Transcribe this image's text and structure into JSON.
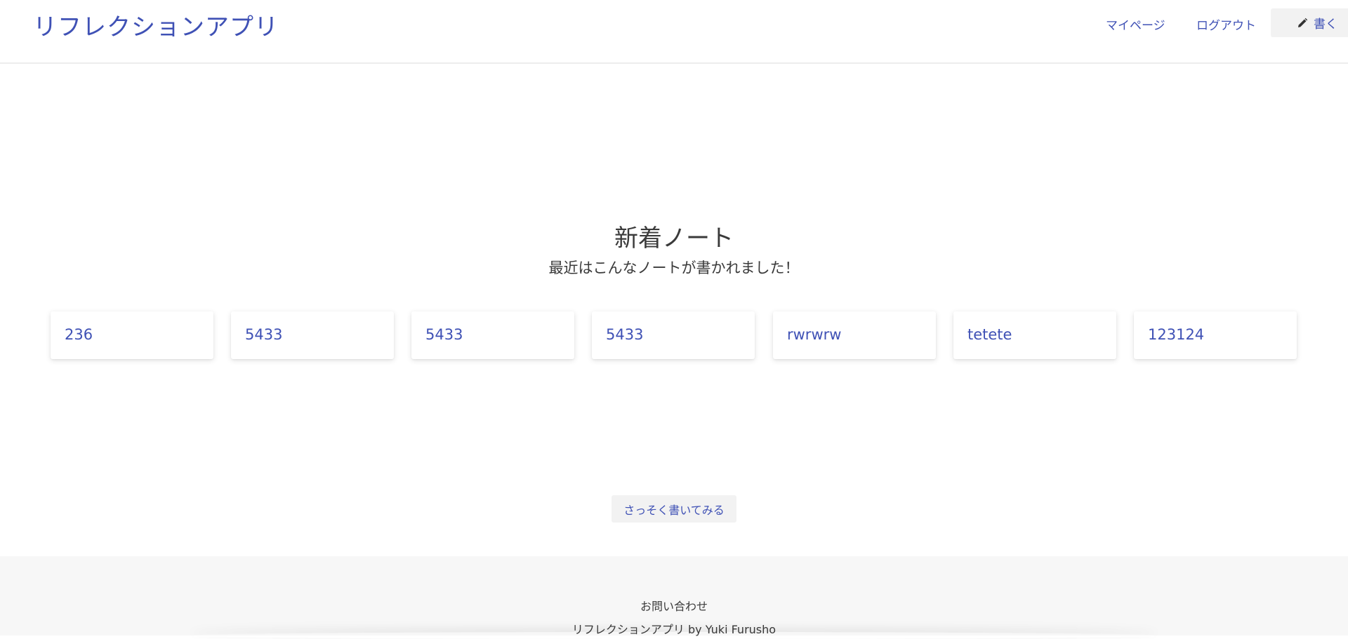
{
  "header": {
    "brand": "リフレクションアプリ",
    "nav": {
      "mypage": "マイページ",
      "logout": "ログアウト",
      "write": "書く",
      "write_icon": "pencil-icon"
    }
  },
  "main": {
    "title": "新着ノート",
    "subtitle": "最近はこんなノートが書かれました！",
    "notes": [
      {
        "title": "236"
      },
      {
        "title": "5433"
      },
      {
        "title": "5433"
      },
      {
        "title": "5433"
      },
      {
        "title": "rwrwrw"
      },
      {
        "title": "tetete"
      },
      {
        "title": "123124"
      }
    ],
    "cta": "さっそく書いてみる"
  },
  "footer": {
    "contact": "お問い合わせ",
    "credit": "リフレクションアプリ by Yuki Furusho"
  },
  "colors": {
    "accent": "#3f51b5",
    "button_bg": "#f2f2f2",
    "footer_bg": "#f7f7f7",
    "text": "#3a3a3a"
  }
}
